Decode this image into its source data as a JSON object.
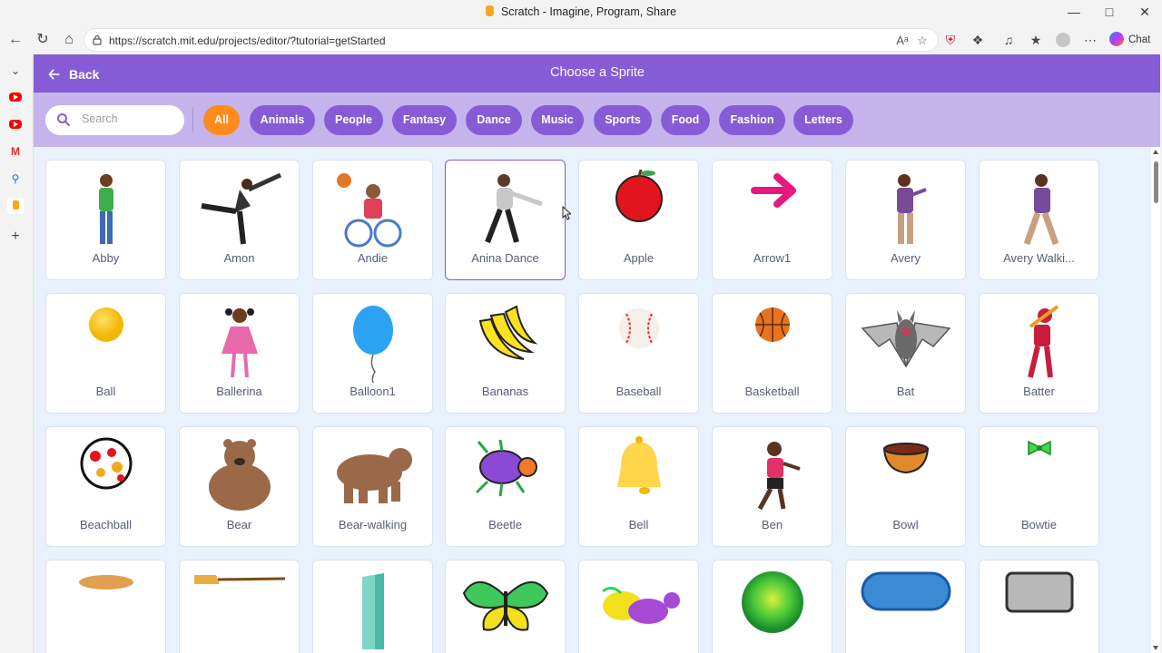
{
  "window": {
    "title": "Scratch - Imagine, Program, Share"
  },
  "browser": {
    "url": "https://scratch.mit.edu/projects/editor/?tutorial=getStarted",
    "chat_label": "Chat"
  },
  "header": {
    "back_label": "Back",
    "title": "Choose a Sprite"
  },
  "search": {
    "placeholder": "Search"
  },
  "tags": [
    "All",
    "Animals",
    "People",
    "Fantasy",
    "Dance",
    "Music",
    "Sports",
    "Food",
    "Fashion",
    "Letters"
  ],
  "active_tag": "All",
  "sprites": [
    "Abby",
    "Amon",
    "Andie",
    "Anina Dance",
    "Apple",
    "Arrow1",
    "Avery",
    "Avery Walki...",
    "Ball",
    "Ballerina",
    "Balloon1",
    "Bananas",
    "Baseball",
    "Basketball",
    "Bat",
    "Batter",
    "Beachball",
    "Bear",
    "Bear-walking",
    "Beetle",
    "Bell",
    "Ben",
    "Bowl",
    "Bowtie",
    "",
    "",
    "",
    "",
    "",
    "",
    "",
    ""
  ],
  "selected_sprite": "Anina Dance",
  "colors": {
    "header": "#855cd6",
    "filterbar": "#c5b4ec",
    "active_tag": "#ff8c1a",
    "grid_bg": "#e9f1fc"
  }
}
